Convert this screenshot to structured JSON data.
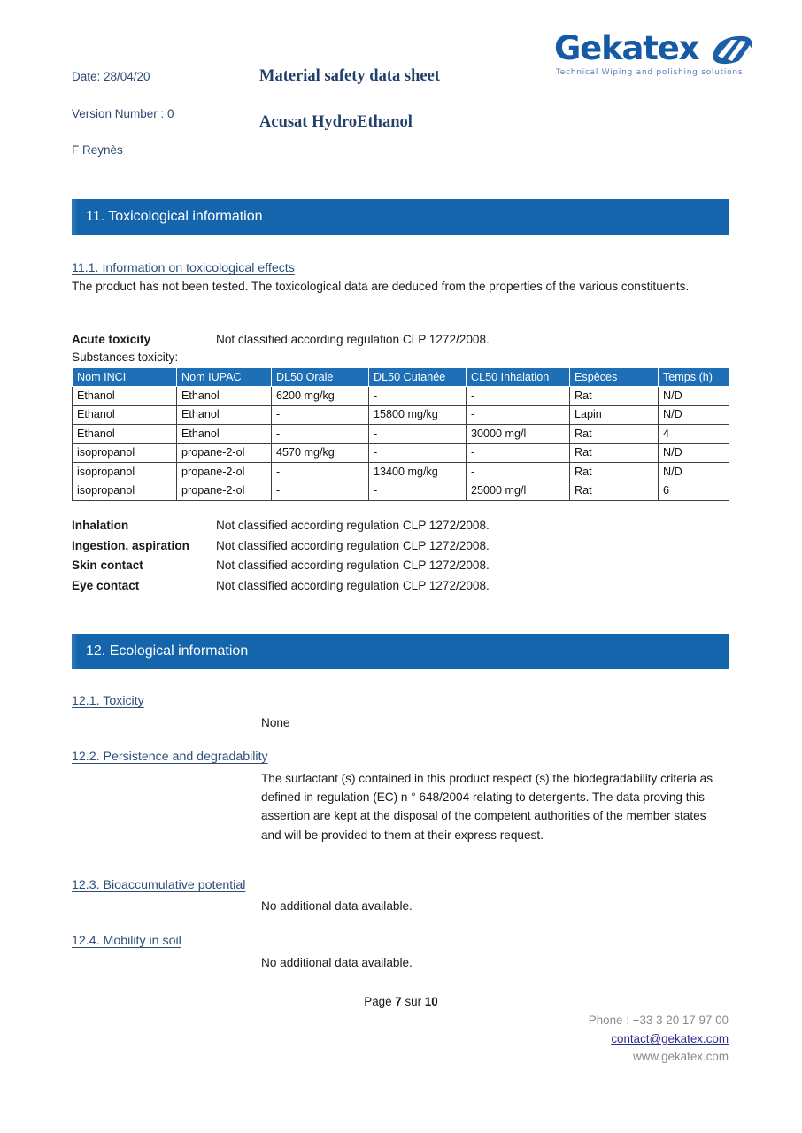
{
  "header": {
    "date_label": "Date: 28/04/20",
    "version_label": "Version Number : 0",
    "author": "F Reynès",
    "title": "Material safety data sheet",
    "subtitle": "Acusat HydroEthanol",
    "logo": {
      "wordmark": "Gekatex",
      "tagline": "Technical Wiping and polishing solutions",
      "swoosh_icon": "swoosh-icon",
      "brand_color": "#145ba4"
    }
  },
  "theme": {
    "section_bar_blue": "#1565ac",
    "table_header_blue": "#1f6fb6",
    "heading_navy": "#21416c",
    "subheading_blue": "#2c4f78"
  },
  "sections": [
    {
      "bar_title": "11. Toxicological information",
      "sub_head": "11.1. Information on toxicological effects",
      "intro": "The product has not been tested. The toxicological data are deduced from the properties of the various constituents.",
      "acute": {
        "key": "Acute toxicity",
        "value": "Not classified according regulation CLP 1272/2008."
      },
      "substances_label": "Substances toxicity:",
      "table": {
        "columns": [
          "Nom INCI",
          "Nom IUPAC",
          "DL50 Orale",
          "DL50 Cutanée",
          "CL50 Inhalation",
          "Espèces",
          "Temps (h)"
        ],
        "rows": [
          [
            "Ethanol",
            "Ethanol",
            "6200 mg/kg",
            "-",
            "-",
            "Rat",
            "N/D"
          ],
          [
            "Ethanol",
            "Ethanol",
            "-",
            "15800 mg/kg",
            "-",
            "Lapin",
            "N/D"
          ],
          [
            "Ethanol",
            "Ethanol",
            "-",
            "-",
            "30000 mg/l",
            "Rat",
            "4"
          ],
          [
            "isopropanol",
            "propane-2-ol",
            "4570 mg/kg",
            "-",
            "-",
            "Rat",
            "N/D"
          ],
          [
            "isopropanol",
            "propane-2-ol",
            "-",
            "13400 mg/kg",
            "-",
            "Rat",
            "N/D"
          ],
          [
            "isopropanol",
            "propane-2-ol",
            "-",
            "-",
            "25000 mg/l",
            "Rat",
            "6"
          ]
        ]
      },
      "routes": [
        {
          "key": "Inhalation",
          "value": "Not classified according regulation CLP 1272/2008."
        },
        {
          "key": "Ingestion, aspiration",
          "value": "Not classified according regulation CLP 1272/2008."
        },
        {
          "key": "Skin contact",
          "value": "Not classified according regulation CLP 1272/2008."
        },
        {
          "key": "Eye contact",
          "value": "Not classified according regulation CLP 1272/2008."
        }
      ]
    },
    {
      "bar_title": "12. Ecological information",
      "items": [
        {
          "head": "12.1. Toxicity",
          "text": "None"
        },
        {
          "head": "12.2. Persistence and degradability",
          "text": "The surfactant (s) contained in this product respect (s) the biodegradability criteria as defined in regulation (EC) n ° 648/2004 relating to detergents. The data proving this assertion are kept at the disposal of the competent authorities of the member states and will be provided to them at their express request."
        },
        {
          "head": "12.3. Bioaccumulative potential",
          "text": "No additional data available."
        },
        {
          "head": "12.4. Mobility in soil",
          "text": "No additional data available."
        }
      ]
    }
  ],
  "footer": {
    "page_prefix": "Page ",
    "page_current": "7",
    "page_middle": " sur ",
    "page_total": "10",
    "phone": "Phone : +33 3 20 17 97 00",
    "email": "contact@gekatex.com",
    "website": "www.gekatex.com"
  }
}
